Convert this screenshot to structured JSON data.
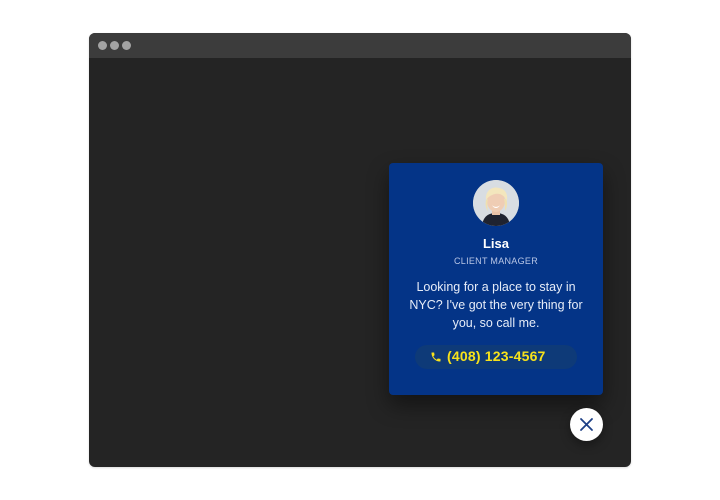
{
  "window": {
    "controls": [
      "window-dot",
      "window-dot",
      "window-dot"
    ],
    "background": "#242424",
    "titlebar_color": "#3c3c3c"
  },
  "widget": {
    "name": "Lisa",
    "role": "CLIENT MANAGER",
    "message": "Looking for a place to stay in NYC? I've got the very thing for you, so call me.",
    "phone": "(408) 123-4567",
    "phone_icon": "phone-icon",
    "avatar_icon": "avatar",
    "close_icon": "close-icon",
    "colors": {
      "card_background": "#043487",
      "phone_text": "#f7e21b",
      "close_icon": "#1d3f86"
    }
  }
}
